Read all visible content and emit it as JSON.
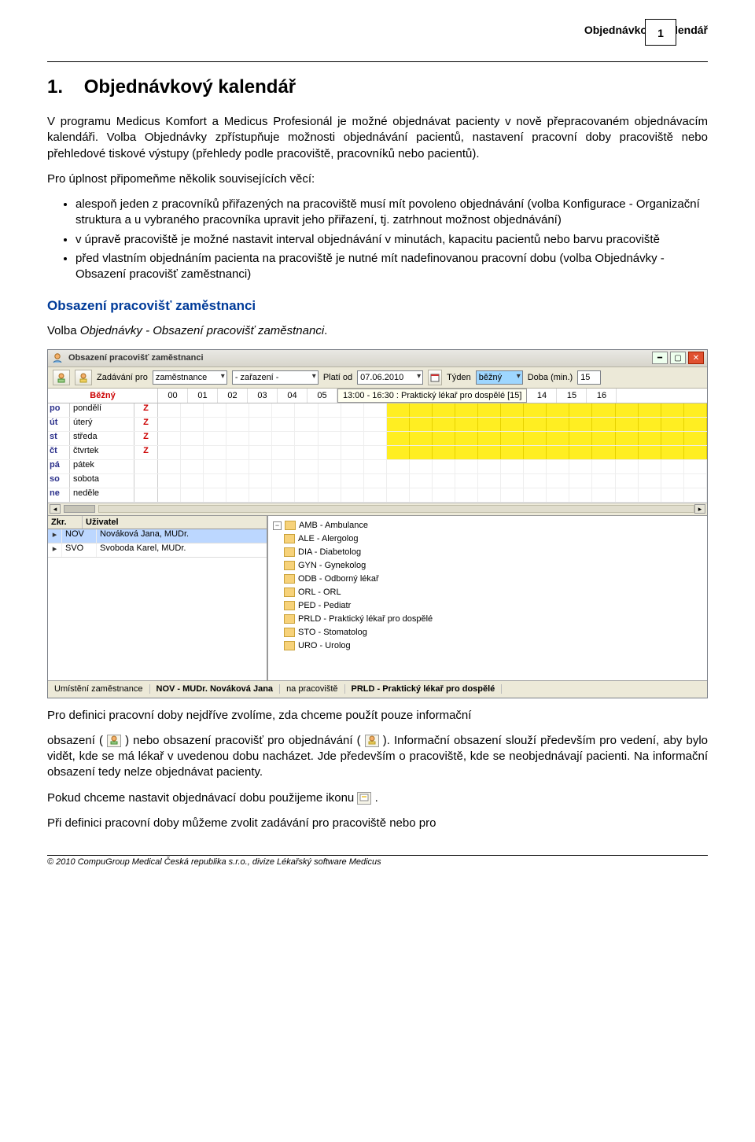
{
  "header": {
    "running_title": "Objednávkový kalendář",
    "page_number": "1"
  },
  "doc": {
    "h1_num": "1.",
    "h1_title": "Objednávkový kalendář",
    "p1": "V programu Medicus Komfort a Medicus Profesionál je možné objednávat pacienty v nově přepracovaném objednávacím kalendáři. Volba Objednávky zpřístupňuje možnosti objednávání pacientů, nastavení pracovní doby pracoviště nebo přehledové tiskové výstupy (přehledy podle pracoviště, pracovníků nebo pacientů).",
    "p2": "Pro úplnost připomeňme několik souvisejících věcí:",
    "bullets": [
      "alespoň jeden z pracovníků přiřazených na pracoviště musí mít povoleno objednávání (volba Konfigurace - Organizační struktura a u vybraného pracovníka upravit jeho přiřazení, tj. zatrhnout možnost objednávání)",
      "v úpravě pracoviště je možné nastavit interval objednávání v minutách, kapacitu pacientů nebo barvu pracoviště",
      "před vlastním objednáním pacienta na pracoviště je nutné mít nadefinovanou pracovní dobu (volba Objednávky - Obsazení pracovišť zaměstnanci)"
    ],
    "h2": "Obsazení pracovišť zaměstnanci",
    "p3_pre": "Volba ",
    "p3_ital": "Objednávky - Obsazení pracovišť zaměstnanci",
    "p3_post": ".",
    "p4": "Pro definici pracovní doby nejdříve zvolíme, zda chceme použít pouze informační",
    "p5a": "obsazení ( ",
    "p5b": " ) nebo obsazení pracovišť pro objednávání ( ",
    "p5c": " ). Informační obsazení slouží především pro vedení, aby bylo vidět, kde se má lékař v uvedenou dobu nacházet. Jde především o pracoviště, kde se neobjednávají pacienti. Na informační obsazení tedy nelze objednávat pacienty.",
    "p6a": "Pokud chceme nastavit objednávací dobu použijeme ikonu ",
    "p6b": ".",
    "p7": "Při definici pracovní doby můžeme zvolit zadávání pro pracoviště nebo pro"
  },
  "win": {
    "title": "Obsazení pracovišť zaměstnanci",
    "toolbar": {
      "zadavani_label": "Zadávání pro",
      "zadavani_value": "zaměstnance",
      "zarazeni_value": "- zařazení -",
      "plati_label": "Platí od",
      "plati_value": "07.06.2010",
      "tyden_label": "Týden",
      "tyden_value": "běžný",
      "doba_label": "Doba (min.)",
      "doba_value": "15"
    },
    "schedule": {
      "type_label": "Běžný",
      "hours_left": [
        "00",
        "01",
        "02",
        "03",
        "04",
        "05"
      ],
      "tooltip": "13:00 - 16:30 : Praktický lékař pro dospělé [15]",
      "hours_right": [
        "14",
        "15",
        "16"
      ],
      "days": [
        {
          "code": "po",
          "name": "pondělí",
          "icon": "Z",
          "fill": true
        },
        {
          "code": "út",
          "name": "úterý",
          "icon": "Z",
          "fill": true
        },
        {
          "code": "st",
          "name": "středa",
          "icon": "Z",
          "fill": true
        },
        {
          "code": "čt",
          "name": "čtvrtek",
          "icon": "Z",
          "fill": true
        },
        {
          "code": "pá",
          "name": "pátek",
          "icon": "",
          "fill": false
        },
        {
          "code": "so",
          "name": "sobota",
          "icon": "",
          "fill": false
        },
        {
          "code": "ne",
          "name": "neděle",
          "icon": "",
          "fill": false
        }
      ]
    },
    "users": {
      "col1": "Zkr.",
      "col2": "Uživatel",
      "rows": [
        {
          "zkr": "NOV",
          "name": "Nováková Jana, MUDr.",
          "sel": true
        },
        {
          "zkr": "SVO",
          "name": "Svoboda Karel, MUDr.",
          "sel": false
        }
      ]
    },
    "tree": [
      "AMB - Ambulance",
      "ALE - Alergolog",
      "DIA - Diabetolog",
      "GYN - Gynekolog",
      "ODB - Odborný lékař",
      "ORL - ORL",
      "PED - Pediatr",
      "PRLD - Praktický lékař pro dospělé",
      "STO - Stomatolog",
      "URO - Urolog"
    ],
    "status": {
      "emp_label": "Umístění zaměstnance",
      "emp_value": "NOV - MUDr. Nováková Jana",
      "ws_label": "na pracoviště",
      "ws_value": "PRLD - Praktický lékař pro dospělé"
    }
  },
  "footer": "© 2010 CompuGroup Medical Česká republika s.r.o., divize Lékařský software Medicus"
}
